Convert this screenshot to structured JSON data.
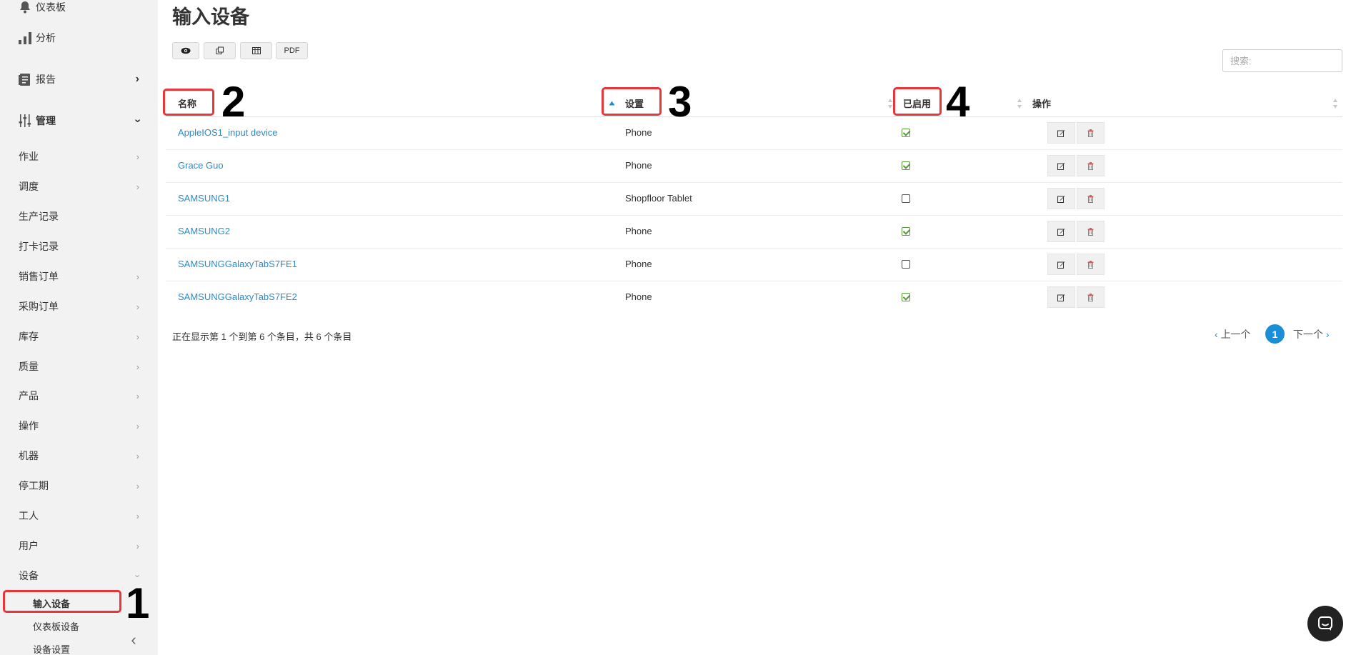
{
  "sidebar": {
    "top_items": [
      {
        "label": "仪表板",
        "icon": "bell-icon"
      },
      {
        "label": "分析",
        "icon": "bar-chart-icon"
      },
      {
        "label": "报告",
        "icon": "report-icon"
      },
      {
        "label": "管理",
        "icon": "settings-sliders-icon"
      }
    ],
    "items": [
      {
        "label": "作业"
      },
      {
        "label": "调度"
      },
      {
        "label": "生产记录"
      },
      {
        "label": "打卡记录"
      },
      {
        "label": "销售订单"
      },
      {
        "label": "采购订单"
      },
      {
        "label": "库存"
      },
      {
        "label": "质量"
      },
      {
        "label": "产品"
      },
      {
        "label": "操作"
      },
      {
        "label": "机器"
      },
      {
        "label": "停工期"
      },
      {
        "label": "工人"
      },
      {
        "label": "用户"
      },
      {
        "label": "设备"
      }
    ],
    "sub_items": [
      {
        "label": "输入设备"
      },
      {
        "label": "仪表板设备"
      },
      {
        "label": "设备设置"
      }
    ]
  },
  "page": {
    "title": "输入设备"
  },
  "toolbar": {
    "pdf_label": "PDF"
  },
  "search": {
    "placeholder": "搜索:"
  },
  "table": {
    "headers": [
      "名称",
      "设置",
      "已启用",
      "操作"
    ],
    "rows": [
      {
        "name": "AppleIOS1_input device",
        "setting": "Phone",
        "enabled": true
      },
      {
        "name": "Grace Guo",
        "setting": "Phone",
        "enabled": true
      },
      {
        "name": "SAMSUNG1",
        "setting": "Shopfloor Tablet",
        "enabled": false
      },
      {
        "name": "SAMSUNG2",
        "setting": "Phone",
        "enabled": true
      },
      {
        "name": "SAMSUNGGalaxyTabS7FE1",
        "setting": "Phone",
        "enabled": false
      },
      {
        "name": "SAMSUNGGalaxyTabS7FE2",
        "setting": "Phone",
        "enabled": true
      }
    ]
  },
  "footer": {
    "info": "正在显示第 1 个到第 6 个条目，共 6 个条目",
    "prev": "上一个",
    "next": "下一个",
    "current_page": "1"
  },
  "annotations": [
    "1",
    "2",
    "3",
    "4"
  ],
  "colors": {
    "accent": "#1a8fd8",
    "link": "#2a8bc8",
    "annotation": "#e8353a",
    "check": "#5a9a3a",
    "delete": "#e05555"
  }
}
